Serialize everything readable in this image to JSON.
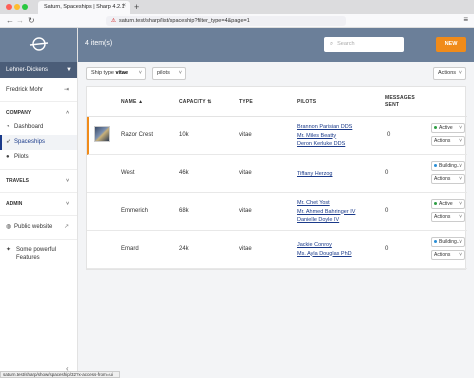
{
  "browser": {
    "tab_title": "Saturn, Spaceships | Sharp 4.2.1",
    "url": "saturn.test/sharp/list/spaceship?filter_type=4&page=1",
    "status_url": "saturn.test/sharp/show/spaceship/32?x-access-from=ui"
  },
  "sidebar": {
    "account": "Lehner-Dickens",
    "user": "Fredrick Mohr",
    "company_section": "COMPANY",
    "items": [
      {
        "label": "Dashboard",
        "icon": "dashboard-icon"
      },
      {
        "label": "Spaceships",
        "icon": "rocket-icon"
      },
      {
        "label": "Pilots",
        "icon": "user-icon"
      }
    ],
    "travels_section": "TRAVELS",
    "admin_section": "ADMIN",
    "public_website": "Public website",
    "features": "Some powerful Features"
  },
  "header": {
    "count": "4 item(s)",
    "search_placeholder": "Search",
    "new_label": "NEW"
  },
  "filters": {
    "type_label": "Ship type",
    "type_value": "vitae",
    "pilots_label": "pilots",
    "actions_label": "Actions"
  },
  "table": {
    "columns": [
      "NAME",
      "CAPACITY",
      "TYPE",
      "PILOTS",
      "MESSAGES SENT"
    ],
    "rows": [
      {
        "name": "Razor Crest",
        "capacity": "10k",
        "type": "vitae",
        "pilots": [
          "Brannon Parisian DDS",
          "Mr. Miles Beatty",
          "Deron Kerluke DDS"
        ],
        "messages": "0",
        "state": "Active",
        "state_color": "#2e9e44",
        "actions": "Actions"
      },
      {
        "name": "West",
        "capacity": "46k",
        "type": "vitae",
        "pilots": [
          "Tiffany Herzog"
        ],
        "messages": "0",
        "state": "Building...",
        "state_color": "#2b8fd6",
        "actions": "Actions"
      },
      {
        "name": "Emmerich",
        "capacity": "68k",
        "type": "vitae",
        "pilots": [
          "Mr. Chet Yost",
          "Mr. Ahmed Bahringer IV",
          "Danielle Doyle IV"
        ],
        "messages": "0",
        "state": "Active",
        "state_color": "#2e9e44",
        "actions": "Actions"
      },
      {
        "name": "Emard",
        "capacity": "24k",
        "type": "vitae",
        "pilots": [
          "Jackie Conroy",
          "Ms. Ayla Douglas PhD"
        ],
        "messages": "0",
        "state": "Building...",
        "state_color": "#2b8fd6",
        "actions": "Actions"
      }
    ]
  }
}
